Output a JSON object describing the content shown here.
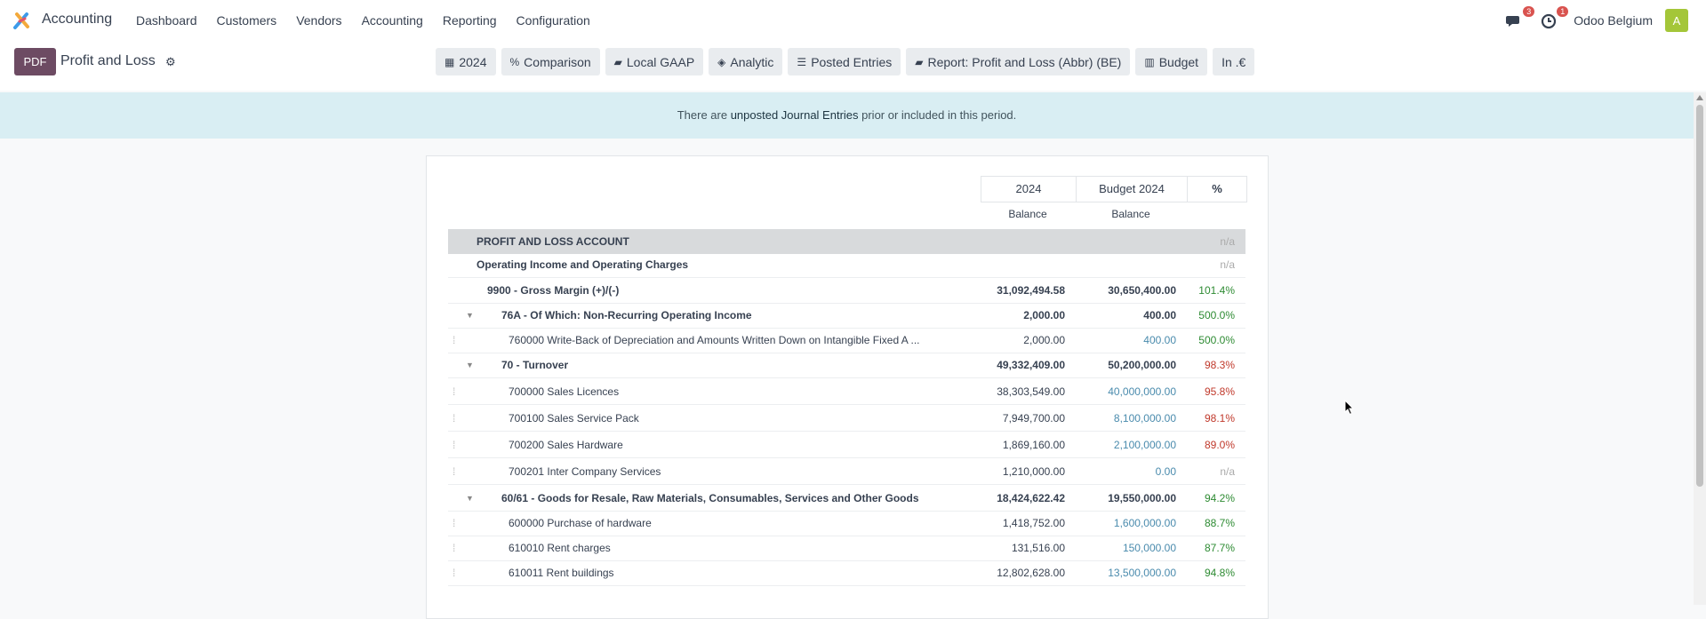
{
  "topbar": {
    "app_name": "Accounting",
    "menu": [
      "Dashboard",
      "Customers",
      "Vendors",
      "Accounting",
      "Reporting",
      "Configuration"
    ],
    "chat_badge": "3",
    "activity_badge": "1",
    "company": "Odoo Belgium",
    "avatar_letter": "A"
  },
  "control": {
    "pdf_label": "PDF",
    "title": "Profit and Loss",
    "filters": [
      {
        "icon": "calendar-icon",
        "glyph": "▦",
        "label": "2024"
      },
      {
        "icon": "percent-icon",
        "glyph": "%",
        "label": "Comparison"
      },
      {
        "icon": "book-icon",
        "glyph": "▰",
        "label": "Local GAAP"
      },
      {
        "icon": "layers-icon",
        "glyph": "◈",
        "label": "Analytic"
      },
      {
        "icon": "sliders-icon",
        "glyph": "☰",
        "label": "Posted Entries"
      },
      {
        "icon": "book-icon",
        "glyph": "▰",
        "label": "Report: Profit and Loss (Abbr) (BE)"
      },
      {
        "icon": "bar-chart-icon",
        "glyph": "▥",
        "label": "Budget"
      },
      {
        "icon": "",
        "glyph": "",
        "label": "In .€"
      }
    ]
  },
  "alert": {
    "prefix": "There are ",
    "link": "unposted Journal Entries",
    "suffix": " prior or included in this period."
  },
  "report": {
    "col1_title": "2024",
    "col2_title": "Budget 2024",
    "col3_title": "%",
    "col1_sub": "Balance",
    "col2_sub": "Balance",
    "rows": [
      {
        "label": "PROFIT AND LOSS ACCOUNT",
        "v1": "",
        "v2": "",
        "pct": "n/a",
        "kind": "band",
        "indent": 1,
        "pctc": "na"
      },
      {
        "label": "Operating Income and Operating Charges",
        "v1": "",
        "v2": "",
        "pct": "n/a",
        "kind": "section",
        "indent": 1,
        "pctc": "na"
      },
      {
        "label": "9900 - Gross Margin (+)/(-)",
        "v1": "31,092,494.58",
        "v2": "30,650,400.00",
        "pct": "101.4%",
        "kind": "total",
        "indent": 2,
        "pctc": "green"
      },
      {
        "label": "76A - Of Which: Non-Recurring Operating Income",
        "v1": "2,000.00",
        "v2": "400.00",
        "pct": "500.0%",
        "kind": "group",
        "indent": 3,
        "pctc": "green"
      },
      {
        "label": "760000 Write-Back of Depreciation and Amounts Written Down on Intangible Fixed A ...",
        "v1": "2,000.00",
        "v2": "400.00",
        "pct": "500.0%",
        "kind": "line",
        "indent": 4,
        "pctc": "green"
      },
      {
        "label": "70 - Turnover",
        "v1": "49,332,409.00",
        "v2": "50,200,000.00",
        "pct": "98.3%",
        "kind": "group",
        "indent": 3,
        "pctc": "red"
      },
      {
        "label": "700000 Sales Licences",
        "v1": "38,303,549.00",
        "v2": "40,000,000.00",
        "pct": "95.8%",
        "kind": "line",
        "indent": 4,
        "pctc": "red"
      },
      {
        "label": "700100 Sales Service Pack",
        "v1": "7,949,700.00",
        "v2": "8,100,000.00",
        "pct": "98.1%",
        "kind": "line",
        "indent": 4,
        "pctc": "red"
      },
      {
        "label": "700200 Sales Hardware",
        "v1": "1,869,160.00",
        "v2": "2,100,000.00",
        "pct": "89.0%",
        "kind": "line",
        "indent": 4,
        "pctc": "red"
      },
      {
        "label": "700201 Inter Company Services",
        "v1": "1,210,000.00",
        "v2": "0.00",
        "pct": "n/a",
        "kind": "line",
        "indent": 4,
        "pctc": "na"
      },
      {
        "label": "60/61 - Goods for Resale, Raw Materials, Consumables, Services and Other Goods",
        "v1": "18,424,622.42",
        "v2": "19,550,000.00",
        "pct": "94.2%",
        "kind": "group",
        "indent": 3,
        "pctc": "green"
      },
      {
        "label": "600000 Purchase of hardware",
        "v1": "1,418,752.00",
        "v2": "1,600,000.00",
        "pct": "88.7%",
        "kind": "line",
        "indent": 4,
        "pctc": "green"
      },
      {
        "label": "610010 Rent charges",
        "v1": "131,516.00",
        "v2": "150,000.00",
        "pct": "87.7%",
        "kind": "line",
        "indent": 4,
        "pctc": "green"
      },
      {
        "label": "610011 Rent buildings",
        "v1": "12,802,628.00",
        "v2": "13,500,000.00",
        "pct": "94.8%",
        "kind": "line",
        "indent": 4,
        "pctc": "green"
      }
    ]
  }
}
